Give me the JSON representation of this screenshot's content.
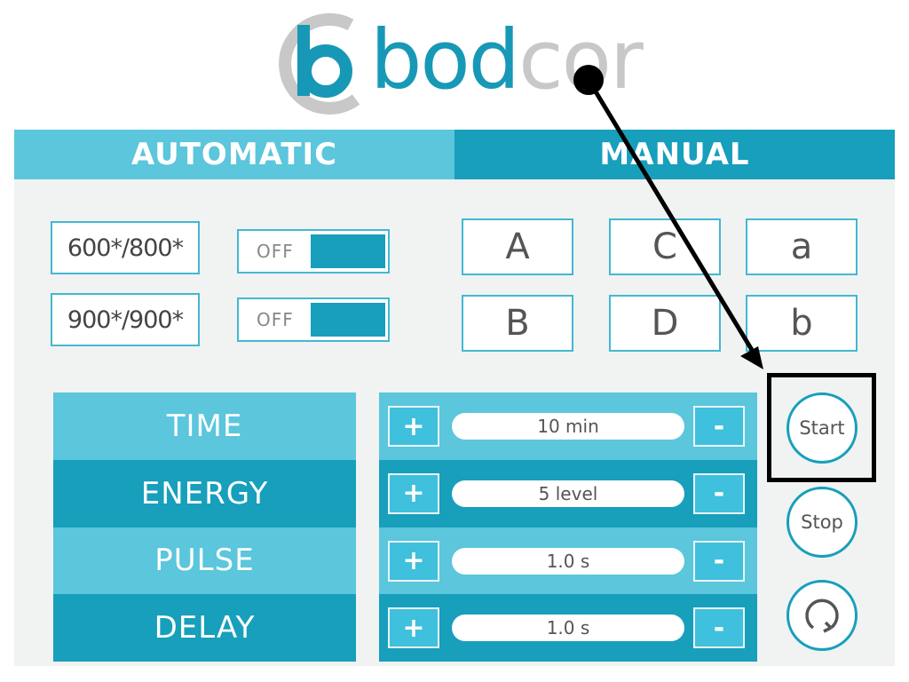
{
  "logo": {
    "brand_part1": "bod",
    "brand_part2": "cor"
  },
  "tabs": [
    {
      "label": "AUTOMATIC"
    },
    {
      "label": "MANUAL"
    }
  ],
  "presets": [
    {
      "value": "600*/800*",
      "toggle": "OFF"
    },
    {
      "value": "900*/900*",
      "toggle": "OFF"
    }
  ],
  "letter_buttons": [
    "A",
    "C",
    "a",
    "B",
    "D",
    "b"
  ],
  "parameters": [
    {
      "label": "TIME",
      "value": "10 min",
      "plus": "+",
      "minus": "-"
    },
    {
      "label": "ENERGY",
      "value": "5 level",
      "plus": "+",
      "minus": "-"
    },
    {
      "label": "PULSE",
      "value": "1.0 s",
      "plus": "+",
      "minus": "-"
    },
    {
      "label": "DELAY",
      "value": "1.0 s",
      "plus": "+",
      "minus": "-"
    }
  ],
  "actions": {
    "start_label": "Start",
    "stop_label": "Stop",
    "reset_icon": "refresh-icon"
  },
  "colors": {
    "accent_light": "#5bc6dc",
    "accent_dark": "#179fbc",
    "button_blue": "#3fc0dd",
    "logo_grey": "#c8c8c8"
  }
}
